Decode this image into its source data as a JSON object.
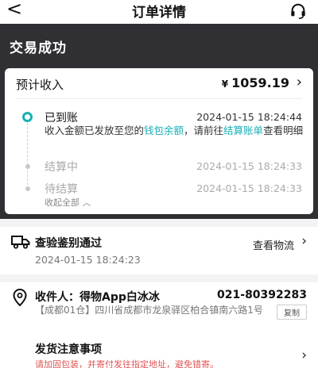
{
  "header": {
    "back_icon": "back-arrow-icon",
    "title": "订单详情",
    "service_icon": "headset-icon"
  },
  "order": {
    "status": "交易成功",
    "expected": {
      "label": "预计收入",
      "currency": "¥",
      "amount": "1059.19"
    },
    "steps": [
      {
        "title": "已到账",
        "time": "2024-01-15 18:24:44",
        "desc_prefix": "收入金额已发放至您的",
        "desc_link1": "钱包余额",
        "desc_mid": "，请前往",
        "desc_link2": "结算账单",
        "desc_suffix": "查看明细"
      },
      {
        "title": "结算中",
        "time": "2024-01-15 18:24:33"
      },
      {
        "title": "待结算",
        "time": "2024-01-15 18:24:33"
      }
    ],
    "collapse_label": "收起全部 ︿"
  },
  "logistics": {
    "title": "查验鉴别通过",
    "time": "2024-01-15 18:24:23",
    "view_label": "查看物流"
  },
  "address": {
    "receiver": "收件人：得物App白冰冰",
    "phone": "021-80392283",
    "detail": "【成都01仓】四川省成都市龙泉驿区柏合镇南六路1号",
    "copy_label": "复制"
  },
  "notice": {
    "title": "发货注意事项",
    "sub": "请加固包装，并寄付发往指定地址，避免错寄。"
  },
  "colors": {
    "accent": "#1aafb8",
    "dark_header": "#2f2f34"
  }
}
